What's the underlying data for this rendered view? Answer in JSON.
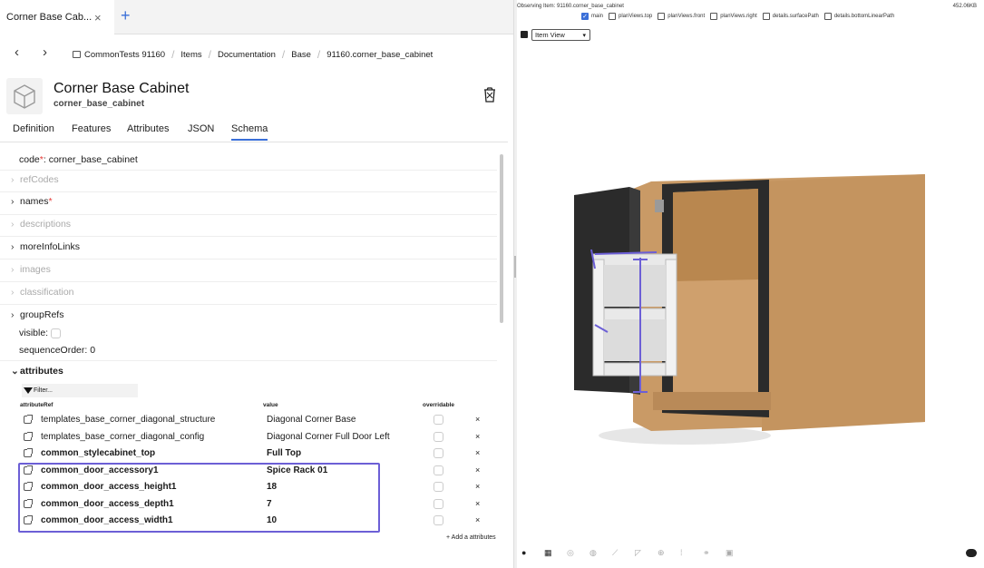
{
  "tab": {
    "title": "Corner Base Cab...",
    "close": "×",
    "new": "+"
  },
  "breadcrumb": {
    "items": [
      "CommonTests 91160",
      "Items",
      "Documentation",
      "Base",
      "91160.corner_base_cabinet"
    ],
    "sep": "/"
  },
  "item": {
    "title": "Corner Base Cabinet",
    "code": "corner_base_cabinet"
  },
  "tabs": [
    "Definition",
    "Features",
    "Attributes",
    "JSON",
    "Schema"
  ],
  "active_tab": "Schema",
  "schema": {
    "code_label": "code",
    "code_value": "corner_base_cabinet",
    "req": "*",
    "refCodes": "refCodes",
    "names": "names",
    "descriptions": "descriptions",
    "moreInfoLinks": "moreInfoLinks",
    "images": "images",
    "classification": "classification",
    "groupRefs": "groupRefs",
    "visible": "visible:",
    "sequenceOrder_label": "sequenceOrder:",
    "sequenceOrder_value": "0",
    "attributes": "attributes",
    "filter": "Filter...",
    "col_ref": "attributeRef",
    "col_value": "value",
    "col_overridable": "overridable",
    "rows": [
      {
        "ref": "templates_base_corner_diagonal_structure",
        "value": "Diagonal Corner Base",
        "bold": false
      },
      {
        "ref": "templates_base_corner_diagonal_config",
        "value": "Diagonal Corner Full Door Left",
        "bold": false
      },
      {
        "ref": "common_stylecabinet_top",
        "value": "Full Top",
        "bold": true
      },
      {
        "ref": "common_door_accessory1",
        "value": "Spice Rack 01",
        "bold": true
      },
      {
        "ref": "common_door_access_height1",
        "value": "18",
        "bold": true
      },
      {
        "ref": "common_door_access_depth1",
        "value": "7",
        "bold": true
      },
      {
        "ref": "common_door_access_width1",
        "value": "10",
        "bold": true
      }
    ],
    "delete": "×",
    "add_attribute": "+ Add a attributes"
  },
  "viewer": {
    "observing": "Observing Item: 91160.corner_base_cabinet",
    "memory": "452.06KB",
    "toggles": [
      {
        "label": "main",
        "checked": true
      },
      {
        "label": "planViews.top",
        "checked": false
      },
      {
        "label": "planViews.front",
        "checked": false
      },
      {
        "label": "planViews.right",
        "checked": false
      },
      {
        "label": "details.surfacePath",
        "checked": false
      },
      {
        "label": "details.bottomLinearPath",
        "checked": false
      }
    ],
    "view_select": "Item View",
    "check": "✓",
    "arrow": "▾",
    "colors": {
      "wood": "#c99a66",
      "door": "#2b2b2b",
      "rack": "#e9e9e9",
      "accent": "#6c5fd6",
      "link": "#3a6fd8"
    }
  }
}
